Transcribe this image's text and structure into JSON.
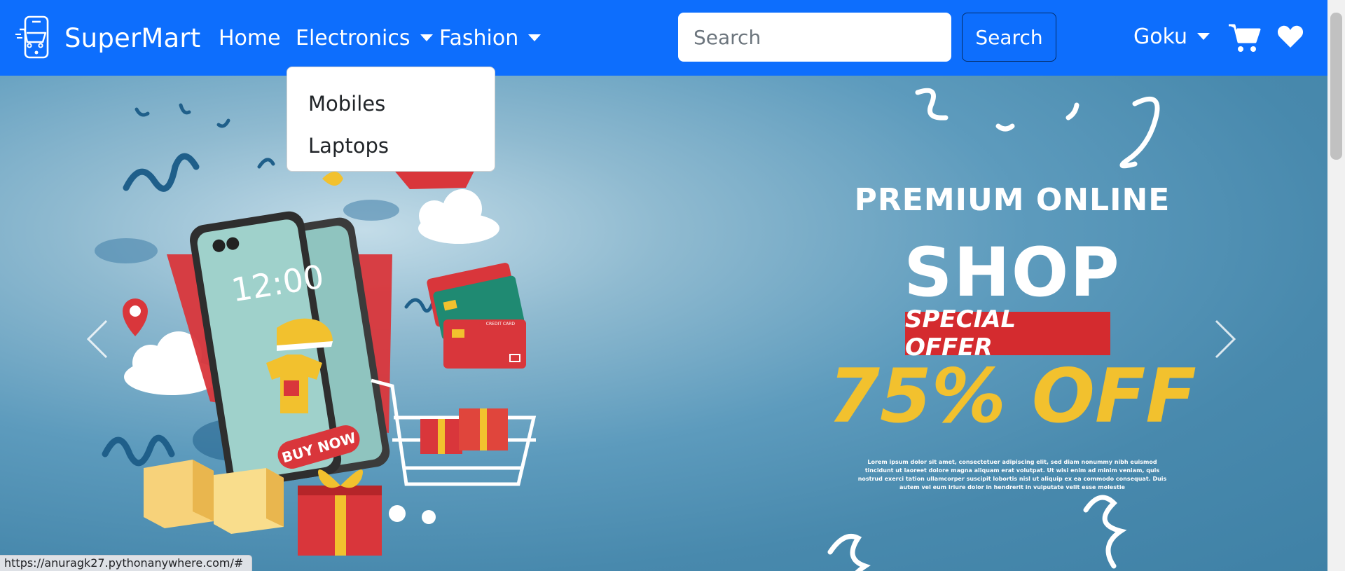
{
  "navbar": {
    "brand": "SuperMart",
    "menu": [
      {
        "label": "Home"
      },
      {
        "label": "Electronics",
        "has_dropdown": true
      },
      {
        "label": "Fashion",
        "has_dropdown": true
      }
    ],
    "search": {
      "placeholder": "Search",
      "value": "",
      "button_label": "Search"
    },
    "user": "Goku",
    "icons": [
      "cart-icon",
      "heart-icon"
    ],
    "accent_color": "#0d6efd"
  },
  "dropdown": {
    "items": [
      "Mobiles",
      "Laptops"
    ]
  },
  "carousel": {
    "promo": {
      "kicker": "PREMIUM ONLINE",
      "title": "SHOP",
      "badge": "SPECIAL OFFER",
      "discount": "75% OFF",
      "fineprint": "Lorem ipsum dolor sit amet, consectetuer adipiscing elit, sed diam nonummy nibh euismod tincidunt ut laoreet dolore magna aliquam erat volutpat. Ut wisi enim ad minim veniam, quis nostrud exerci tation ullamcorper suscipit lobortis nisl ut aliquip ex ea commodo consequat. Duis autem vel eum iriure dolor in hendrerit in vulputate velit esse molestie"
    },
    "phone_time": "12:00",
    "phone_button": "BUY NOW",
    "credit_card_label": "CREDIT CARD",
    "controls": [
      "chevron-left-icon",
      "chevron-right-icon"
    ]
  },
  "status_url": "https://anuragk27.pythonanywhere.com/#"
}
